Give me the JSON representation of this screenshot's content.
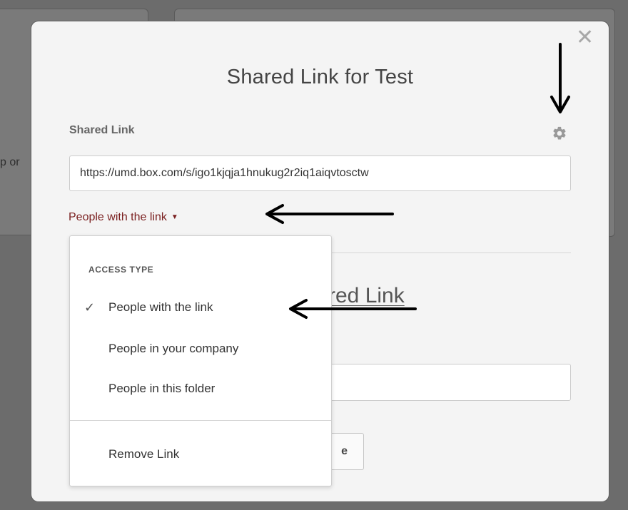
{
  "background": {
    "partial_text": "p or"
  },
  "modal": {
    "title": "Shared Link for Test",
    "close_glyph": "✕",
    "section_label": "Shared Link",
    "gear_icon": "gear-icon",
    "shared_link_url": "https://umd.box.com/s/igo1kjqja1hnukug2r2iq1aiqvtosctw",
    "access_toggle_label": "People with the link",
    "caret": "▼",
    "partial_heading": "red Link",
    "partial_button_label": "e"
  },
  "dropdown": {
    "header": "ACCESS TYPE",
    "checkmark": "✓",
    "options": [
      {
        "label": "People with the link",
        "selected": true
      },
      {
        "label": "People in your company",
        "selected": false
      },
      {
        "label": "People in this folder",
        "selected": false
      }
    ],
    "remove_label": "Remove Link"
  },
  "colors": {
    "accent_link": "#7a1f1f",
    "overlay": "#6c6c6c",
    "modal_bg": "#f4f4f4"
  }
}
